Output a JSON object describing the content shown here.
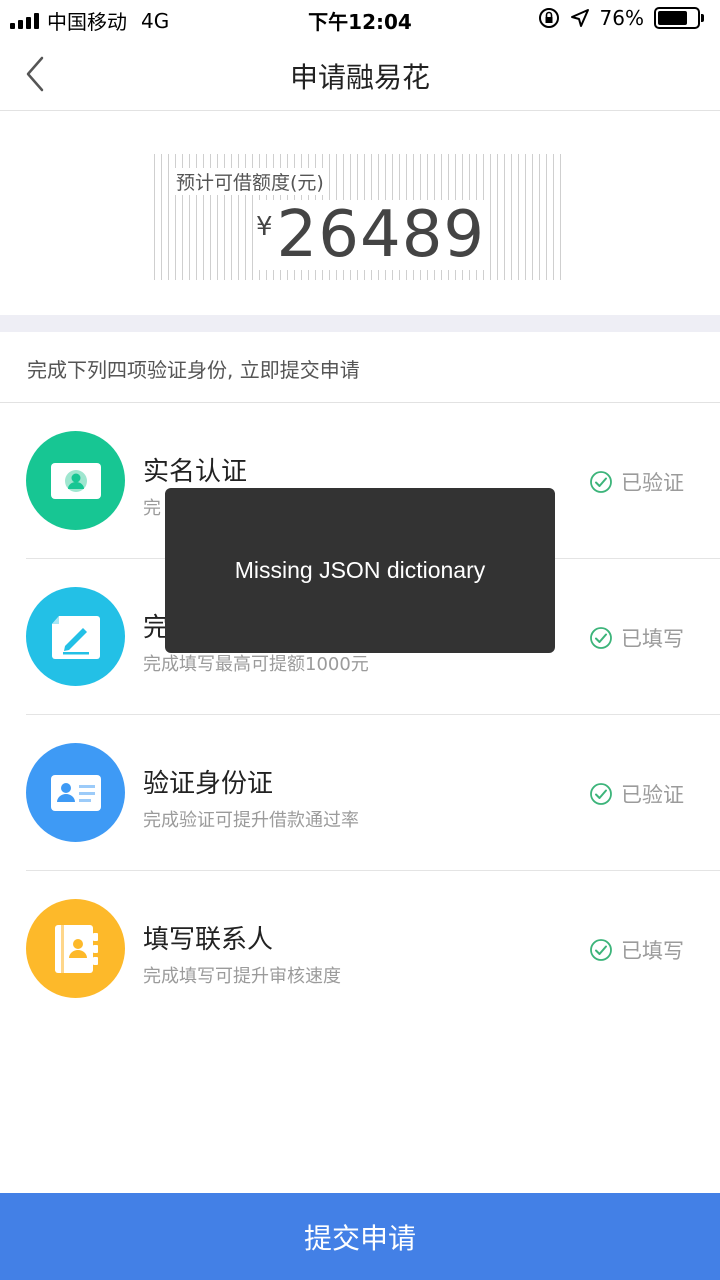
{
  "status_bar": {
    "carrier": "中国移动",
    "network": "4G",
    "time": "下午12:04",
    "battery_text": "76%",
    "battery_level": 0.76
  },
  "nav": {
    "title": "申请融易花",
    "back_icon": "chevron-left-icon"
  },
  "amount": {
    "label": "预计可借额度(元)",
    "currency": "¥",
    "value": "26489"
  },
  "instruction": "完成下列四项验证身份, 立即提交申请",
  "items": [
    {
      "title": "实名认证",
      "subtitle": "完",
      "status": "已验证",
      "icon": "id-photo-icon",
      "color": "#17c693"
    },
    {
      "title": "完",
      "subtitle": "完成填写最高可提额1000元",
      "status": "已填写",
      "icon": "edit-document-icon",
      "color": "#23c0e6"
    },
    {
      "title": "验证身份证",
      "subtitle": "完成验证可提升借款通过率",
      "status": "已验证",
      "icon": "id-card-icon",
      "color": "#3e9af5"
    },
    {
      "title": "填写联系人",
      "subtitle": "完成填写可提升审核速度",
      "status": "已填写",
      "icon": "contacts-book-icon",
      "color": "#fdb92a"
    }
  ],
  "toast": "Missing JSON dictionary",
  "submit_label": "提交申请",
  "colors": {
    "check": "#3cb47a",
    "primary": "#4380e6"
  }
}
